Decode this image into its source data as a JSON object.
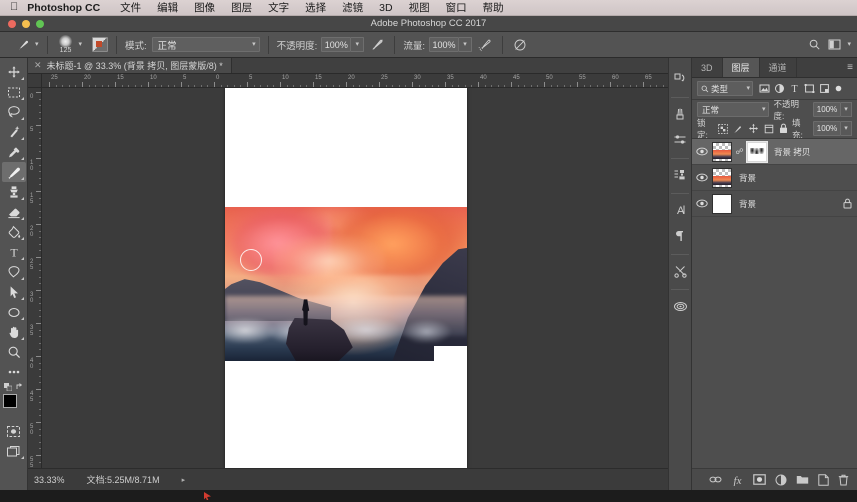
{
  "macbar": {
    "apple_icon": "apple-logo-icon",
    "app_name": "Photoshop CC",
    "menus": [
      "文件",
      "编辑",
      "图像",
      "图层",
      "文字",
      "选择",
      "滤镜",
      "3D",
      "视图",
      "窗口",
      "帮助"
    ]
  },
  "titlebar": {
    "title": "Adobe Photoshop CC 2017",
    "traffic_lights": [
      "close",
      "minimize",
      "zoom"
    ]
  },
  "options_bar": {
    "tool_icon": "brush-icon",
    "brush_size": "125",
    "brush_panel_icon": "brush-panel-icon",
    "mode_label": "模式:",
    "mode_value": "正常",
    "opacity_label": "不透明度:",
    "opacity_value": "100%",
    "opacity_pressure_icon": "pressure-opacity-icon",
    "flow_label": "流量:",
    "flow_value": "100%",
    "airbrush_icon": "airbrush-icon",
    "smoothing_icon": "smoothing-icon",
    "search_icon": "search-icon",
    "workspace_icon": "workspace-icon"
  },
  "document_tab": {
    "close_icon": "close-icon",
    "label": "未标题-1 @ 33.3% (背景 拷贝, 图层蒙版/8) *"
  },
  "toolbar": {
    "tools": [
      {
        "name": "move-tool",
        "icon": "move-icon",
        "active": false,
        "has_flyout": true
      },
      {
        "name": "marquee-tool",
        "icon": "rectangular-marquee-icon",
        "active": false,
        "has_flyout": true
      },
      {
        "name": "lasso-tool",
        "icon": "lasso-icon",
        "active": false,
        "has_flyout": true
      },
      {
        "name": "quick-selection-tool",
        "icon": "magic-wand-icon",
        "active": false,
        "has_flyout": true
      },
      {
        "name": "eyedropper-tool",
        "icon": "eyedropper-icon",
        "active": false,
        "has_flyout": true
      },
      {
        "name": "brush-tool",
        "icon": "brush-icon",
        "active": true,
        "has_flyout": true
      },
      {
        "name": "clone-stamp-tool",
        "icon": "clone-stamp-icon",
        "active": false,
        "has_flyout": true
      },
      {
        "name": "eraser-tool",
        "icon": "eraser-icon",
        "active": false,
        "has_flyout": true
      },
      {
        "name": "gradient-tool",
        "icon": "paint-bucket-icon",
        "active": false,
        "has_flyout": true
      },
      {
        "name": "type-tool",
        "icon": "text-icon",
        "active": false,
        "has_flyout": true
      },
      {
        "name": "pen-tool",
        "icon": "pen-icon",
        "active": false,
        "has_flyout": true
      },
      {
        "name": "path-selection-tool",
        "icon": "path-arrow-icon",
        "active": false,
        "has_flyout": true
      },
      {
        "name": "shape-tool",
        "icon": "ellipse-icon",
        "active": false,
        "has_flyout": true
      },
      {
        "name": "hand-tool",
        "icon": "hand-icon",
        "active": false,
        "has_flyout": true
      },
      {
        "name": "zoom-tool",
        "icon": "magnifier-icon",
        "active": false,
        "has_flyout": false
      },
      {
        "name": "more-tools",
        "icon": "ellipsis-icon",
        "active": false,
        "has_flyout": false
      }
    ],
    "swap_colors_icon": "swap-colors-icon",
    "default_colors_icon": "default-colors-icon",
    "foreground_color": "#000000",
    "background_color": "#ffffff",
    "quick_mask_icon": "quick-mask-icon",
    "screen_mode_icon": "screen-mode-icon"
  },
  "rulers": {
    "unit_hint": "cm",
    "horizontal_labels": [
      "25",
      "20",
      "15",
      "10",
      "5",
      "0",
      "5",
      "10",
      "15",
      "20",
      "25",
      "30",
      "35",
      "40",
      "45",
      "50",
      "55",
      "60",
      "65"
    ],
    "vertical_labels": [
      "0",
      "5",
      "10",
      "15",
      "20",
      "25",
      "30",
      "35",
      "40",
      "45",
      "50",
      "55"
    ]
  },
  "canvas": {
    "artboard_bg": "#ffffff",
    "photo_description": "日落山景，人物剪影站在悬崖上",
    "brush_cursor": "brush-cursor-circle"
  },
  "statusbar": {
    "zoom": "33.33%",
    "doc_size": "文档:5.25M/8.71M",
    "expand_icon": "expand-arrow-icon"
  },
  "dock": {
    "icons": [
      {
        "name": "history-icon",
        "glyph": "history"
      },
      {
        "name": "brush-settings-icon",
        "glyph": "brush"
      },
      {
        "name": "adjustments-icon",
        "glyph": "sliders"
      },
      {
        "name": "brush-presets-icon",
        "glyph": "presets"
      },
      {
        "name": "character-icon",
        "glyph": "A"
      },
      {
        "name": "paragraph-icon",
        "glyph": "pilcrow"
      },
      {
        "name": "tool-presets-icon",
        "glyph": "scissors"
      },
      {
        "name": "color-icon",
        "glyph": "swirl"
      }
    ]
  },
  "panel": {
    "tabs": [
      {
        "name": "tab-3d",
        "label": "3D",
        "active": false
      },
      {
        "name": "tab-layers",
        "label": "图层",
        "active": true
      },
      {
        "name": "tab-channels",
        "label": "通道",
        "active": false
      }
    ],
    "menu_icon": "panel-menu-icon",
    "filter": {
      "search_icon": "search-icon",
      "type_label": "类型",
      "caret_icon": "chevron-down-icon",
      "filter_icons": [
        "pixel-filter-icon",
        "adjustment-filter-icon",
        "type-filter-icon",
        "shape-filter-icon",
        "smart-object-filter-icon",
        "toggle-filter-icon"
      ]
    },
    "blend_mode": "正常",
    "opacity_label": "不透明度:",
    "opacity_value": "100%",
    "lock_label": "锁定:",
    "lock_icons": [
      "lock-transparent-icon",
      "lock-image-icon",
      "lock-position-icon",
      "lock-artboard-icon",
      "lock-all-icon"
    ],
    "fill_label": "填充:",
    "fill_value": "100%",
    "layers": [
      {
        "name": "背景 拷贝",
        "visible": true,
        "selected": true,
        "has_mask": true,
        "linked": true,
        "locked": false,
        "thumb_type": "image"
      },
      {
        "name": "背景",
        "visible": true,
        "selected": false,
        "has_mask": false,
        "linked": false,
        "locked": false,
        "thumb_type": "image"
      },
      {
        "name": "背景",
        "visible": true,
        "selected": false,
        "has_mask": false,
        "linked": false,
        "locked": true,
        "thumb_type": "white"
      }
    ],
    "footer_icons": [
      "link-layers-icon",
      "layer-style-fx-icon",
      "add-mask-icon",
      "adjustment-layer-icon",
      "new-group-icon",
      "new-layer-icon",
      "delete-layer-icon"
    ]
  }
}
